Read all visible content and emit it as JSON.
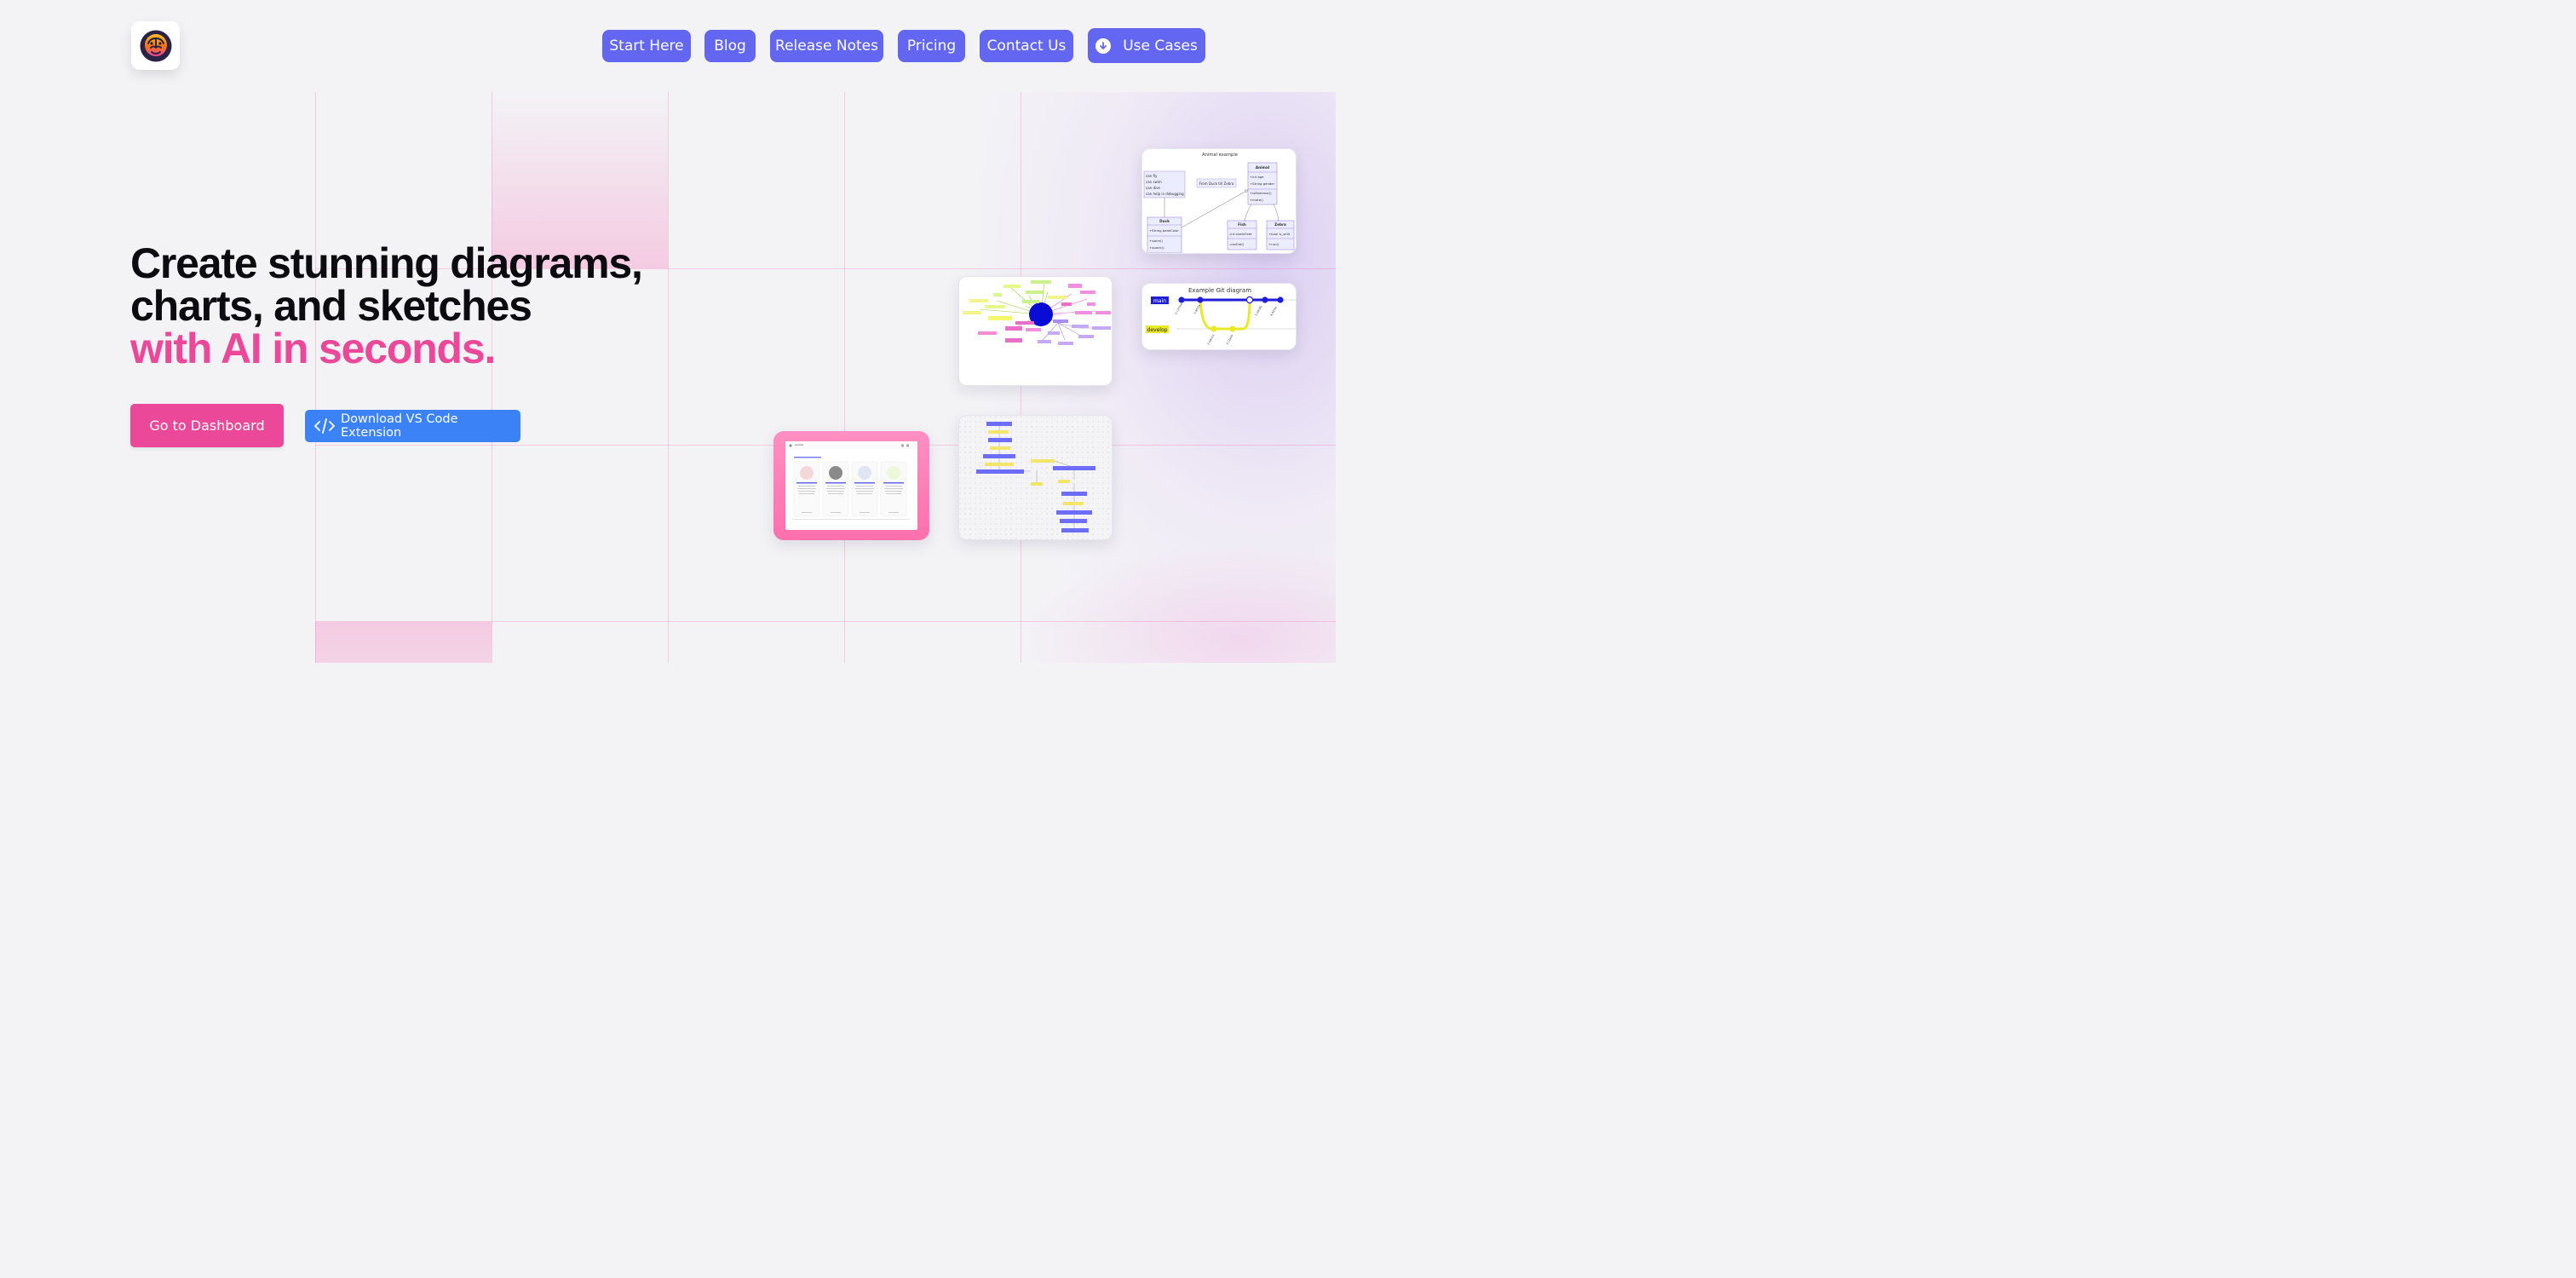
{
  "brand": {
    "accent_pink": "#ec4899",
    "nav_purple": "#6366f1",
    "vscode_blue": "#3b82f6"
  },
  "nav": {
    "items": [
      {
        "label": "Start Here"
      },
      {
        "label": "Blog"
      },
      {
        "label": "Release Notes"
      },
      {
        "label": "Pricing"
      },
      {
        "label": "Contact Us"
      },
      {
        "label": "Use Cases",
        "icon": "download-circle-icon"
      }
    ]
  },
  "hero": {
    "line1": "Create stunning diagrams,",
    "line2": "charts, and sketches",
    "line3": "with AI in seconds."
  },
  "cta": {
    "primary_label": "Go to Dashboard",
    "secondary_label": "Download VS Code Extension",
    "secondary_icon": "code-brackets-icon"
  },
  "previews": {
    "class_diagram": {
      "title": "Animal example",
      "note_lines": [
        "can fly",
        "can swim",
        "can dive",
        "can help in debugging"
      ],
      "relation_label": "From Duck till Zebra",
      "animal": {
        "name": "Animal",
        "fields": [
          "+int age",
          "+String gender"
        ],
        "methods": [
          "+isMammal()",
          "+mate()"
        ]
      },
      "duck": {
        "name": "Duck",
        "fields": [
          "+String beakColor"
        ],
        "methods": [
          "+swim()",
          "+quack()"
        ]
      },
      "fish": {
        "name": "Fish",
        "fields": [
          "-int sizeInFeet"
        ],
        "methods": [
          "-canEat()"
        ]
      },
      "zebra": {
        "name": "Zebra",
        "fields": [
          "+bool is_wild"
        ],
        "methods": [
          "+run()"
        ]
      }
    },
    "git_diagram": {
      "title": "Example Git diagram",
      "branch_main": "main",
      "branch_develop": "develop"
    }
  }
}
